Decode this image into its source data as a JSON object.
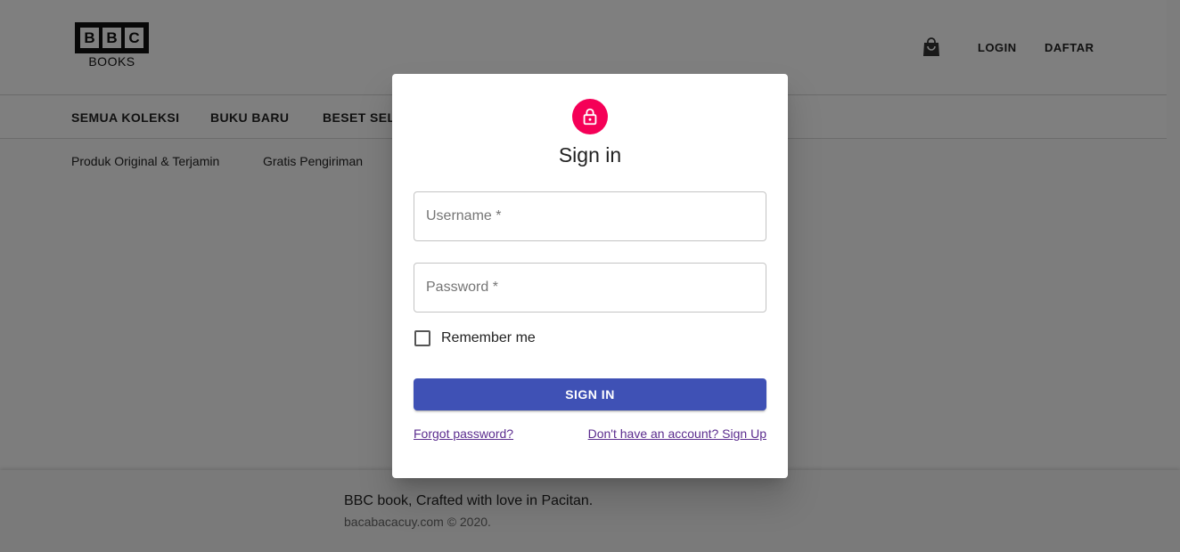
{
  "header": {
    "logo_letters": [
      "B",
      "B",
      "C"
    ],
    "logo_sub": "BOOKS",
    "cart_icon": "shopping-bag-icon",
    "login_label": "LOGIN",
    "register_label": "DAFTAR"
  },
  "menu": {
    "items": [
      "SEMUA KOLEKSI",
      "BUKU BARU",
      "BESET SELL"
    ]
  },
  "infobar": {
    "items": [
      "Produk Original & Terjamin",
      "Gratis Pengiriman"
    ]
  },
  "footer": {
    "line1": "BBC book, Crafted with love in Pacitan.",
    "line2": "bacabacacuy.com © 2020."
  },
  "modal": {
    "icon": "lock-icon",
    "title": "Sign in",
    "username_label": "Username *",
    "password_label": "Password *",
    "remember_label": "Remember me",
    "signin_label": "SIGN IN",
    "forgot_label": "Forgot password?",
    "signup_label": "Don't have an account? Sign Up"
  },
  "colors": {
    "avatar": "#f50057",
    "primary_button": "#3f51b5",
    "link": "#5b2c8e"
  }
}
